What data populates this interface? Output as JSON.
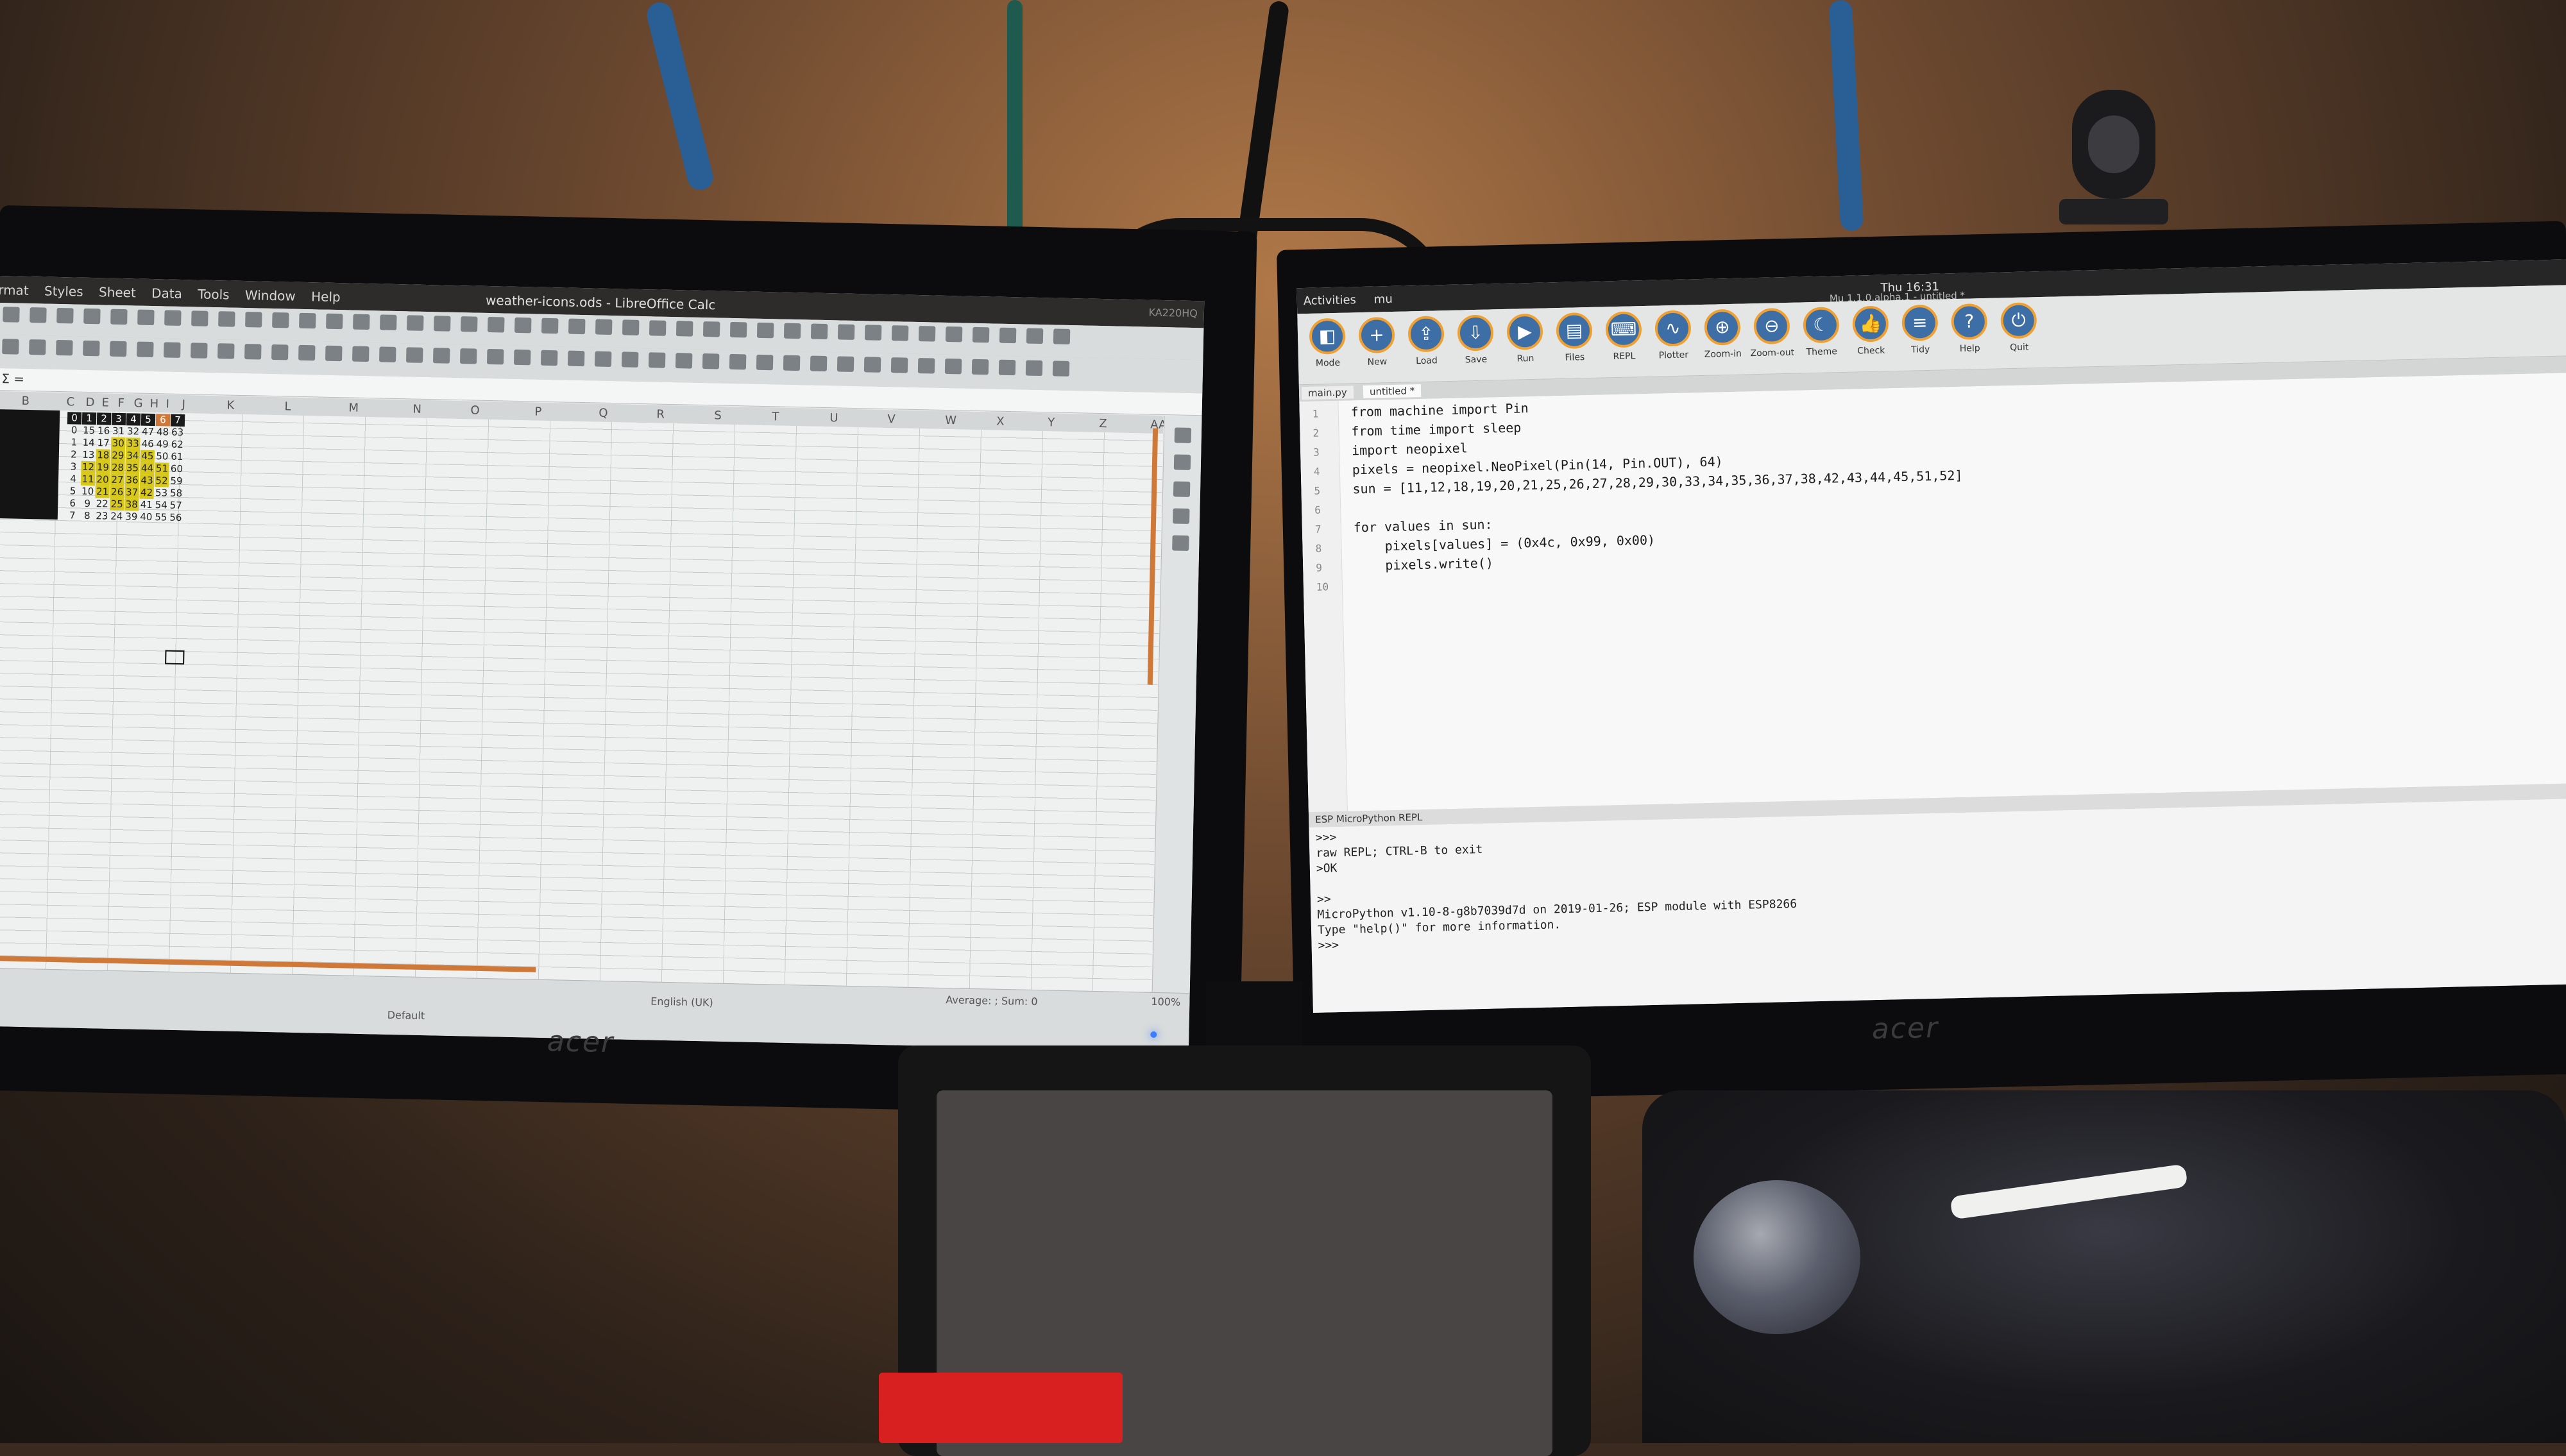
{
  "scene": {
    "description_items": [
      "two-monitors",
      "tablet",
      "webcam",
      "desk-clutter"
    ]
  },
  "left_monitor": {
    "brand": "acer",
    "model_label": "KA220HQ",
    "window_title": "weather-icons.ods - LibreOffice Calc",
    "menu": [
      "rmat",
      "Styles",
      "Sheet",
      "Data",
      "Tools",
      "Window",
      "Help"
    ],
    "formula_prefix": "Σ =",
    "columns": [
      "B",
      "C",
      "D",
      "E",
      "F",
      "G",
      "H",
      "I",
      "J",
      "K",
      "L",
      "M",
      "N",
      "O",
      "P",
      "Q",
      "R",
      "S",
      "T",
      "U",
      "V",
      "W",
      "X",
      "Y",
      "Z",
      "AA"
    ],
    "table_header": [
      "0",
      "1",
      "2",
      "3",
      "4",
      "5",
      "6",
      "7"
    ],
    "table_rows": [
      [
        "0",
        "15",
        "16",
        "31",
        "32",
        "47",
        "48",
        "63"
      ],
      [
        "1",
        "14",
        "17",
        "30",
        "33",
        "46",
        "49",
        "62"
      ],
      [
        "2",
        "13",
        "18",
        "29",
        "34",
        "45",
        "50",
        "61"
      ],
      [
        "3",
        "12",
        "19",
        "28",
        "35",
        "44",
        "51",
        "60"
      ],
      [
        "4",
        "11",
        "20",
        "27",
        "36",
        "43",
        "52",
        "59"
      ],
      [
        "5",
        "10",
        "21",
        "26",
        "37",
        "42",
        "53",
        "58"
      ],
      [
        "6",
        "9",
        "22",
        "25",
        "38",
        "41",
        "54",
        "57"
      ],
      [
        "7",
        "8",
        "23",
        "24",
        "39",
        "40",
        "55",
        "56"
      ]
    ],
    "status": {
      "style": "Default",
      "language": "English (UK)",
      "summary": "Average: ; Sum: 0",
      "zoom": "100%"
    }
  },
  "right_monitor": {
    "brand": "acer",
    "top_bar": {
      "activities": "Activities",
      "app_menu": "mu",
      "clock": "Thu 16:31",
      "window_title": "Mu 1.1.0.alpha.1 - untitled *"
    },
    "toolbar": [
      {
        "label": "Mode",
        "glyph": "◧"
      },
      {
        "label": "New",
        "glyph": "+"
      },
      {
        "label": "Load",
        "glyph": "⇪"
      },
      {
        "label": "Save",
        "glyph": "⇩"
      },
      {
        "label": "Run",
        "glyph": "▶"
      },
      {
        "label": "Files",
        "glyph": "▤"
      },
      {
        "label": "REPL",
        "glyph": "⌨"
      },
      {
        "label": "Plotter",
        "glyph": "∿"
      },
      {
        "label": "Zoom-in",
        "glyph": "⊕"
      },
      {
        "label": "Zoom-out",
        "glyph": "⊖"
      },
      {
        "label": "Theme",
        "glyph": "☾"
      },
      {
        "label": "Check",
        "glyph": "👍"
      },
      {
        "label": "Tidy",
        "glyph": "≡"
      },
      {
        "label": "Help",
        "glyph": "?"
      },
      {
        "label": "Quit",
        "glyph": "⏻"
      }
    ],
    "tabs": [
      "main.py",
      "untitled *"
    ],
    "code_lines": [
      "from machine import Pin",
      "from time import sleep",
      "import neopixel",
      "pixels = neopixel.NeoPixel(Pin(14, Pin.OUT), 64)",
      "sun = [11,12,18,19,20,21,25,26,27,28,29,30,33,34,35,36,37,38,42,43,44,45,51,52]",
      "",
      "for values in sun:",
      "    pixels[values] = (0x4c, 0x99, 0x00)",
      "    pixels.write()",
      ""
    ],
    "repl_title": "ESP MicroPython REPL",
    "repl_lines": [
      ">>>",
      "raw REPL; CTRL-B to exit",
      ">OK",
      "",
      ">>",
      "MicroPython v1.10-8-g8b7039d7d on 2019-01-26; ESP module with ESP8266",
      "Type \"help()\" for more information.",
      ">>>"
    ]
  },
  "colors": {
    "mu_accent": "#f0a030",
    "mu_icon": "#3d6ea6",
    "calc_highlight": "#d8c81a",
    "calc_header": "#1a1a1a"
  }
}
